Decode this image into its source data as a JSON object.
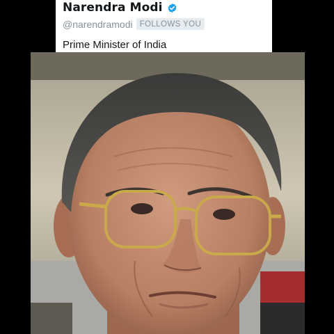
{
  "profile": {
    "name": "Narendra Modi",
    "handle": "@narendramodi",
    "follows_badge": "FOLLOWS YOU",
    "bio": "Prime Minister of India",
    "verified_icon": "verified-badge-icon",
    "verified_color": "#1da1f2"
  },
  "photo": {
    "subject": "portrait-photo"
  }
}
